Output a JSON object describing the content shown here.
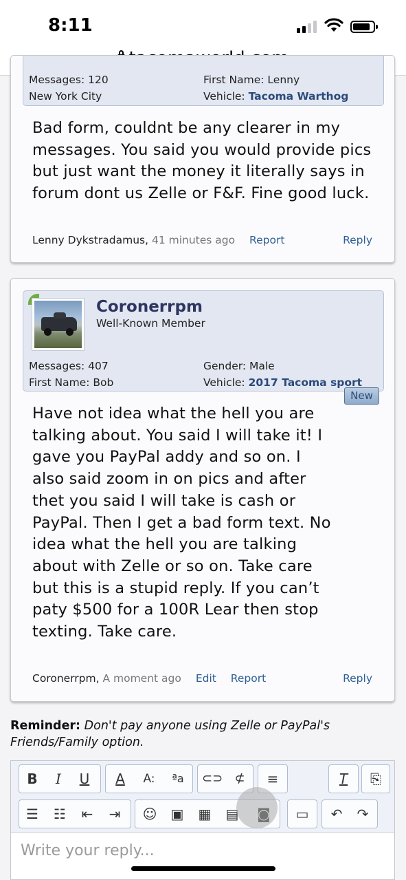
{
  "status": {
    "time": "8:11"
  },
  "browser": {
    "url": "tacomaworld.com"
  },
  "post1": {
    "messages": "Messages: 120",
    "location": "New York City",
    "first_name": "First Name: Lenny",
    "vehicle_label": "Vehicle:",
    "vehicle": "Tacoma Warthog",
    "body_lines": [
      "Bad form, couldnt be any clearer in my",
      "messages. You said you would provide pics",
      "but just want the money it literally says in",
      "forum dont us Zelle or F&F. Fine good luck."
    ],
    "author": "Lenny Dykstradamus,",
    "time_ago": "41 minutes ago",
    "report": "Report",
    "reply": "Reply"
  },
  "post2": {
    "username": "Coronerrpm",
    "role": "Well-Known Member",
    "messages": "Messages: 407",
    "first_name": "First Name: Bob",
    "gender": "Gender: Male",
    "vehicle_label": "Vehicle:",
    "vehicle": "2017 Tacoma sport",
    "badge": "New",
    "body_lines": [
      "Have not idea what the hell you are",
      "talking about. You said I will take it! I",
      "gave you PayPal addy and so on. I",
      "also said zoom in on pics and after",
      "thet you said I will take is cash or",
      "PayPal. Then I get a bad form text. No",
      "idea what the hell you are talking",
      "about with Zelle or so on. Take care",
      "but this is a stupid reply. If you can’t",
      "paty $500 for a 100R Lear then stop",
      "texting. Take care."
    ],
    "author": "Coronerrpm,",
    "time_ago": "A moment ago",
    "edit": "Edit",
    "report": "Report",
    "reply": "Reply"
  },
  "reminder": {
    "label": "Reminder:",
    "line1": "Don't pay anyone using Zelle or PayPal's",
    "line2": "Friends/Family option."
  },
  "editor": {
    "placeholder": "Write your reply...",
    "toolbar_icons": [
      "bold-icon",
      "italic-icon",
      "underline-icon",
      "text-color-icon",
      "font-size-icon",
      "font-family-icon",
      "link-icon",
      "unlink-icon",
      "align-icon",
      "remove-format-icon",
      "undo-style-icon",
      "bullet-list-icon",
      "numbered-list-icon",
      "outdent-icon",
      "indent-icon",
      "smilie-icon",
      "image-icon",
      "media-icon",
      "code-icon",
      "camera-icon",
      "save-draft-icon",
      "undo-icon",
      "redo-icon"
    ]
  }
}
